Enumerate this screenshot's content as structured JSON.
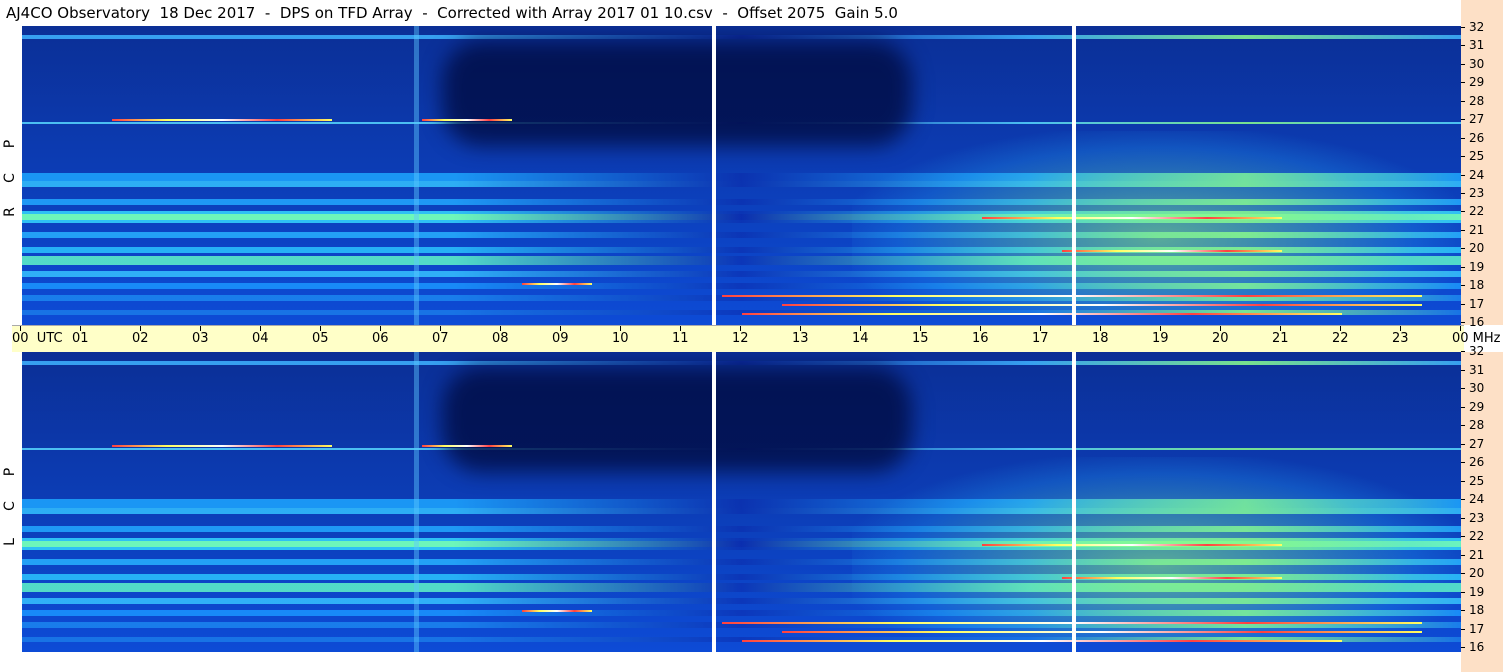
{
  "title": "AJ4CO Observatory  18 Dec 2017  -  DPS on TFD Array  -  Corrected with Array 2017 01 10.csv  -  Offset 2075  Gain 5.0",
  "top_panel": {
    "label_chars": [
      "P",
      "C",
      "R"
    ]
  },
  "bottom_panel": {
    "label_chars": [
      "P",
      "C",
      "L"
    ]
  },
  "time_axis": {
    "labels": [
      "00  UTC",
      "01",
      "02",
      "03",
      "04",
      "05",
      "06",
      "07",
      "08",
      "09",
      "10",
      "11",
      "12",
      "13",
      "14",
      "15",
      "16",
      "17",
      "18",
      "19",
      "20",
      "21",
      "22",
      "23",
      "00 MHz"
    ]
  },
  "freq_axis": {
    "labels": [
      "32",
      "31",
      "30",
      "29",
      "28",
      "27",
      "26",
      "25",
      "24",
      "23",
      "22",
      "21",
      "20",
      "19",
      "18",
      "17",
      "16"
    ]
  },
  "colors": {
    "background_low": "#0b2f96",
    "band_cyan": "#1ec8ff",
    "band_green": "#6aff9a",
    "time_axis_bg": "#ffffc8",
    "freq_axis_bg": "#fde0c6",
    "marker": "#ffffff"
  }
}
